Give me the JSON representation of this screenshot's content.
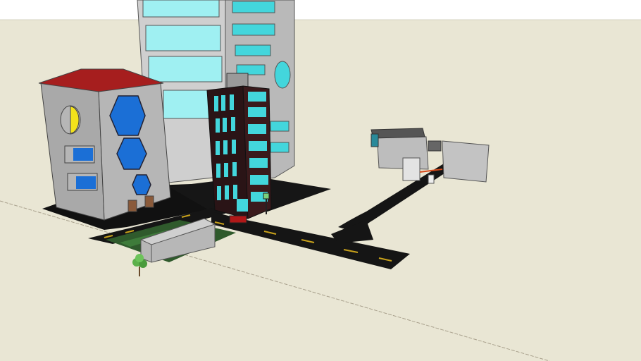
{
  "scene": {
    "description_free": true,
    "colors": {
      "sky": "#ffffff",
      "ground": "#e9e6d4",
      "road": "#161616",
      "lane_marking": "#c9a21b",
      "grass": "#2f5a2c",
      "roof_red": "#a61e1e",
      "wall_gray": "#b4b4b4",
      "glass_cyan": "#43d6dc",
      "window_blue": "#1b6fd6",
      "tower_dark": "#2a1416",
      "sun_yellow": "#f3e21b"
    }
  }
}
